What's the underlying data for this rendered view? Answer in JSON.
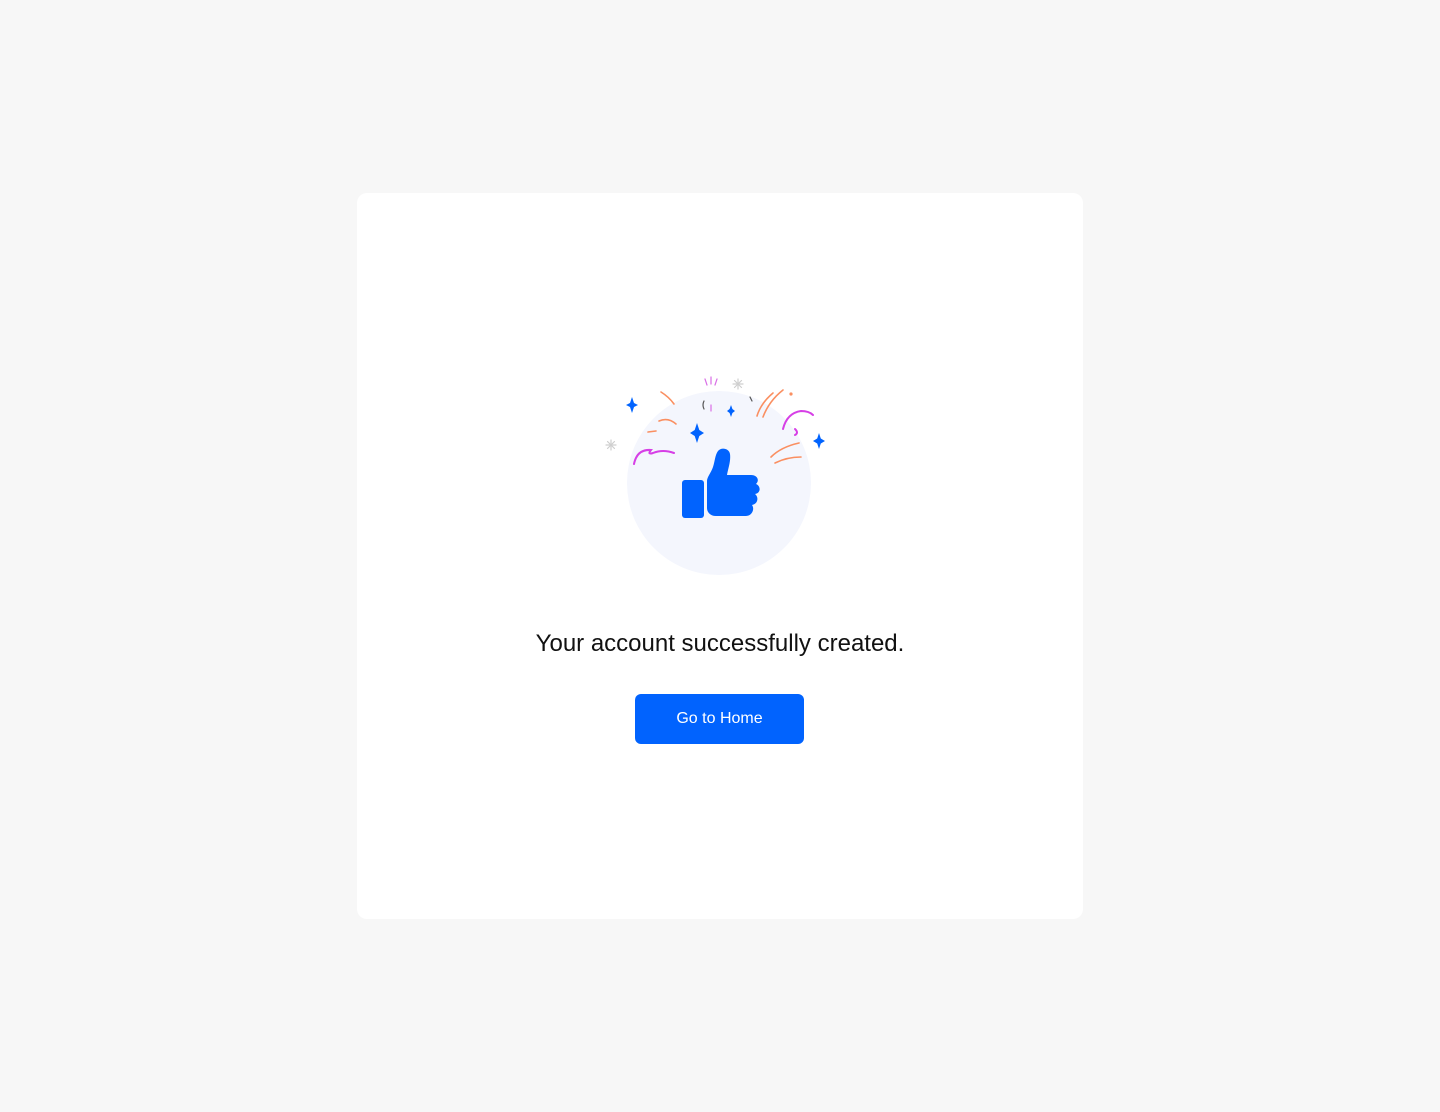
{
  "success": {
    "message": "Your account successfully created.",
    "button_label": "Go to Home"
  },
  "illustration": {
    "icon": "thumbs-up-icon",
    "decorations": [
      "sparkle-icon",
      "confetti-icon"
    ]
  },
  "colors": {
    "background": "#f7f7f7",
    "card": "#ffffff",
    "accent": "#0163fe",
    "circle": "#f4f6fd",
    "confetti_orange": "#fa8f61",
    "confetti_magenta": "#d63fe6",
    "sparkle_gray": "#cfcfcf"
  }
}
